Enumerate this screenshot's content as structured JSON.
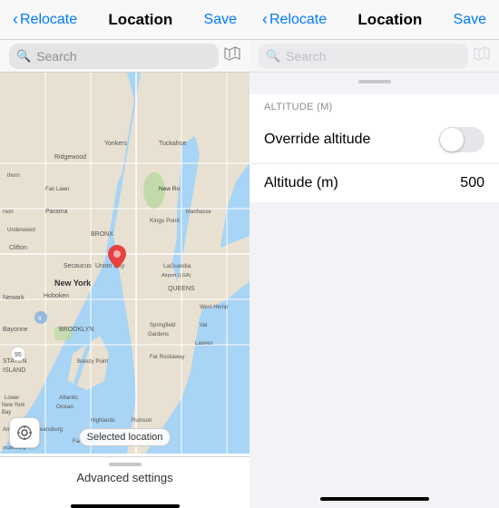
{
  "left": {
    "nav": {
      "back_label": "Relocate",
      "title": "Location",
      "action": "Save"
    },
    "search": {
      "placeholder": "Search",
      "map_icon": "□"
    },
    "map": {
      "selected_location_text": "Selected location",
      "advanced_settings_label": "Advanced settings"
    }
  },
  "right": {
    "nav": {
      "back_label": "Relocate",
      "title": "Location",
      "action": "Save"
    },
    "search": {
      "placeholder": "Search"
    },
    "altitude": {
      "section_label": "ALTITUDE (M)",
      "override_label": "Override altitude",
      "altitude_label": "Altitude (m)",
      "altitude_value": "500"
    }
  }
}
